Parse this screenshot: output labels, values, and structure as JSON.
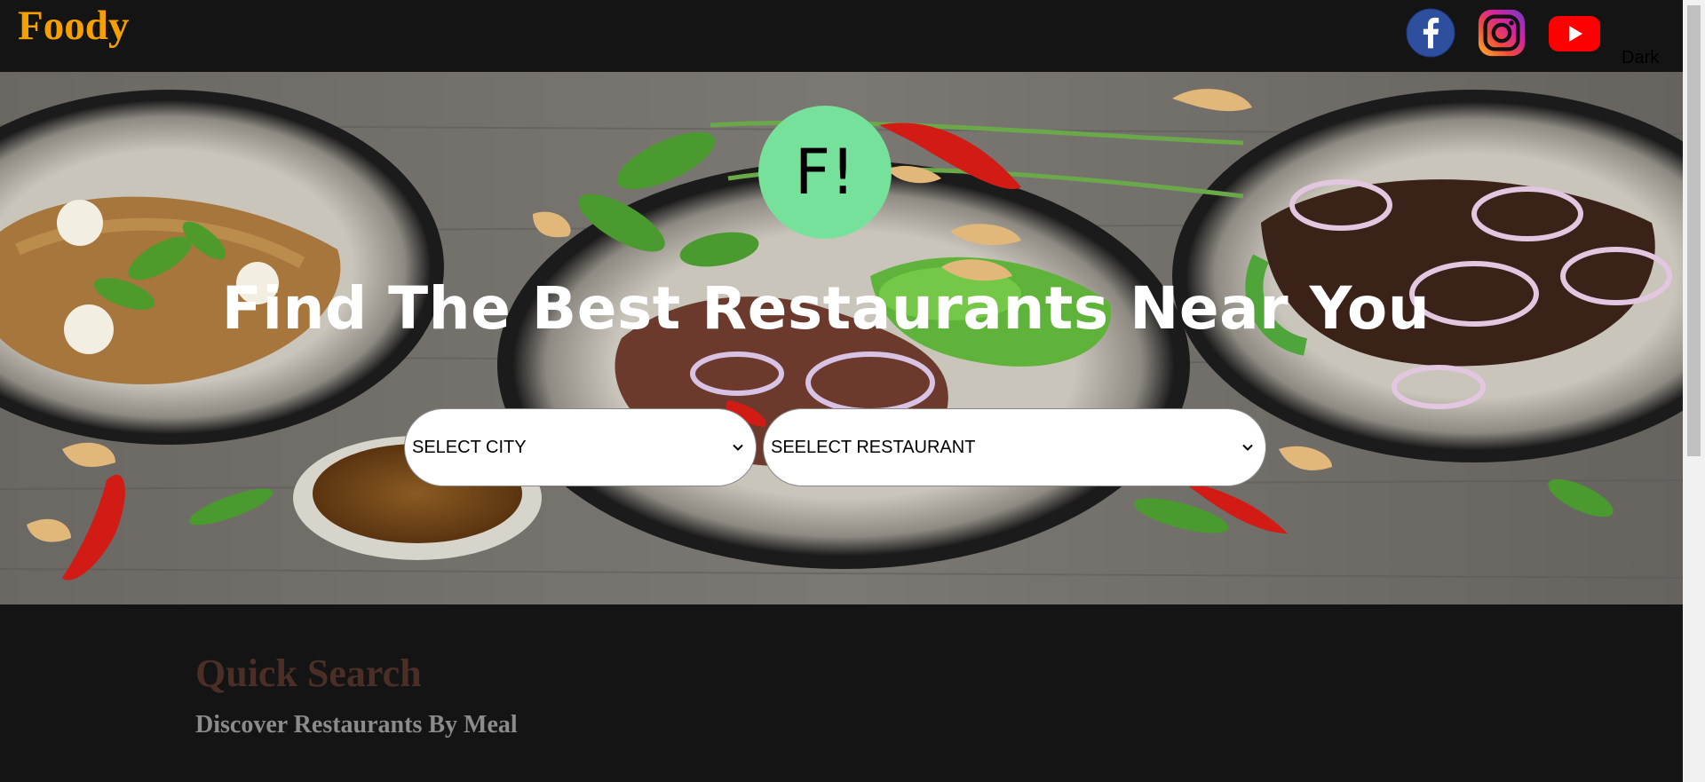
{
  "header": {
    "brand": "Foody",
    "social": [
      {
        "name": "facebook",
        "icon": "facebook-icon",
        "color": "#2d4f9e"
      },
      {
        "name": "instagram",
        "icon": "instagram-icon",
        "color": "#d6249f"
      },
      {
        "name": "youtube",
        "icon": "youtube-icon",
        "color": "#ff0000"
      }
    ],
    "mode_toggle": "Dark"
  },
  "hero": {
    "logo_text": "F!",
    "title": "Find The Best Restaurants Near You",
    "select_city": {
      "value": "SELECT CITY"
    },
    "select_restaurant": {
      "value": "SEELECT RESTAURANT"
    }
  },
  "quick_search": {
    "title": "Quick Search",
    "subtitle": "Discover Restaurants By Meal"
  },
  "colors": {
    "brand": "#f5a000",
    "logo_bg": "#76e19a",
    "background": "#141414",
    "quick_title": "#4b2f26",
    "quick_subtitle": "#8b8b8b"
  }
}
